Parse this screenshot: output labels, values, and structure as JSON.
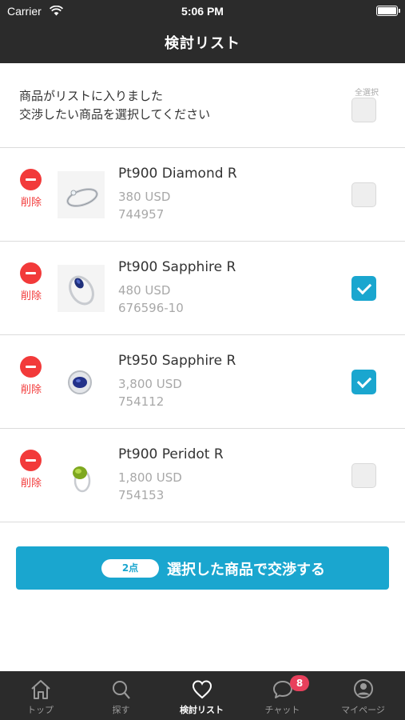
{
  "status_bar": {
    "carrier": "Carrier",
    "time": "5:06 PM"
  },
  "nav": {
    "title": "検討リスト"
  },
  "header": {
    "message_line1": "商品がリストに入りました",
    "message_line2": "交渉したい商品を選択してください",
    "select_all_label": "全選択",
    "select_all_checked": false
  },
  "items": [
    {
      "name": "Pt900 Diamond R",
      "price": "380 USD",
      "code": "744957",
      "delete_label": "削除",
      "checked": false,
      "thumb_icon": "diamond-ring-icon"
    },
    {
      "name": "Pt900 Sapphire R",
      "price": "480 USD",
      "code": "676596-10",
      "delete_label": "削除",
      "checked": true,
      "thumb_icon": "sapphire-ring-icon"
    },
    {
      "name": "Pt950 Sapphire R",
      "price": "3,800 USD",
      "code": "754112",
      "delete_label": "削除",
      "checked": true,
      "thumb_icon": "sapphire-halo-ring-icon"
    },
    {
      "name": "Pt900 Peridot R",
      "price": "1,800 USD",
      "code": "754153",
      "delete_label": "削除",
      "checked": false,
      "thumb_icon": "peridot-ring-icon"
    }
  ],
  "action": {
    "count_label": "2点",
    "label": "選択した商品で交渉する"
  },
  "tabs": [
    {
      "label": "トップ",
      "icon": "home-icon",
      "active": false
    },
    {
      "label": "探す",
      "icon": "search-icon",
      "active": false
    },
    {
      "label": "検討リスト",
      "icon": "heart-icon",
      "active": true
    },
    {
      "label": "チャット",
      "icon": "chat-icon",
      "active": false,
      "badge": "8"
    },
    {
      "label": "マイページ",
      "icon": "user-icon",
      "active": false
    }
  ],
  "colors": {
    "accent": "#1aa6cf",
    "danger": "#f23a3a",
    "bar": "#2b2b2b",
    "badge": "#e8405c"
  }
}
